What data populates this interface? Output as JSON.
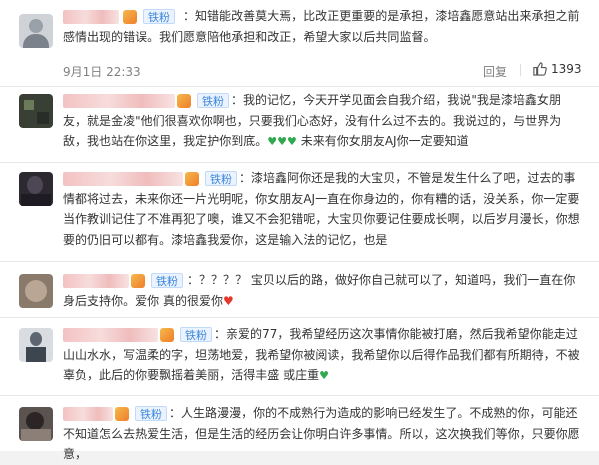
{
  "comments": [
    {
      "badge": "铁粉",
      "text": "：知错能改善莫大焉，比改正更重要的是承担，漆培鑫愿意站出来承担之前感情出现的错误。我们愿意陪他承担和改正，希望大家以后共同监督。",
      "time": "9月1日 22:33",
      "reply": "回复",
      "likes": "1393"
    },
    {
      "badge": "铁粉",
      "text": "：我的记忆，今天开学见面会自我介绍，我说\"我是漆培鑫女朋友，就是金凌\"他们很喜欢你啊也，只要我们心态好，没有什么过不去的。我说过的，与世界为敌，我也站在你这里，我定护你到底。💚💚💚 未来有你女朋友AJ你一定要知道"
    },
    {
      "badge": "铁粉",
      "text": "：漆培鑫阿你还是我的大宝贝，不管是发生什么了吧，过去的事情都将过去，未来你还一片光明呢，你女朋友AJ一直在你身边的，你有糟的话，没关系，你一定要当作教训记住了不准再犯了噢，谁又不会犯错呢，大宝贝你要记住要成长啊，以后岁月漫长，你想要的仍旧可以都有。漆培鑫我爱你，这是输入法的记忆，也是"
    },
    {
      "badge": "铁粉",
      "text": "：？？？？ 宝贝以后的路，做好你自己就可以了，知道吗，我们一直在你身后支持你。爱你 真的很爱你❤️"
    },
    {
      "badge": "铁粉",
      "text": "：亲爱的77，我希望经历这次事情你能被打磨，然后我希望你能走过山山水水，写温柔的字，坦荡地爱，我希望你被阅读，我希望你以后得作品我们都有所期待，不被辜负，此后的你要飘摇着美丽，活得丰盛 或庄重💚"
    },
    {
      "badge": "铁粉",
      "text": "：人生路漫漫，你的不成熟行为造成的影响已经发生了。不成熟的你，可能还不知道怎么去热爱生活，但是生活的经历会让你明白许多事情。所以，这次换我们等你，只要你愿意，"
    }
  ],
  "colors": {
    "badge_blue": "#3d86d9",
    "heart_green": "#2fa84f",
    "heart_red": "#e5372b"
  },
  "icons": {
    "like": "thumb-up-icon",
    "heart": "green-heart-icon",
    "vip": "vip-badge-icon"
  }
}
